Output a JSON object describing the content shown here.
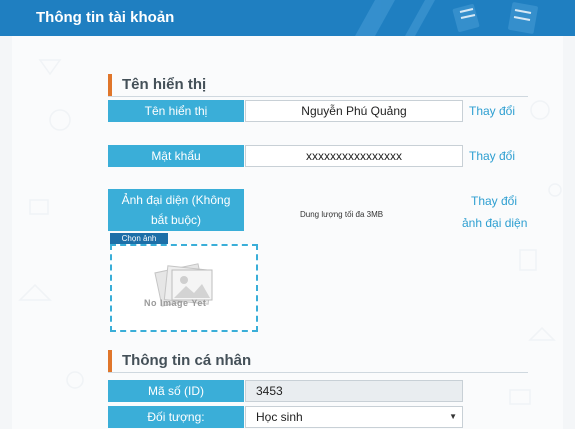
{
  "header": {
    "title": "Thông tin tài khoản"
  },
  "display_section": {
    "title": "Tên hiển thị"
  },
  "display_name": {
    "label": "Tên hiển thị",
    "value": "Nguyễn Phú Quảng",
    "action": "Thay đổi"
  },
  "password": {
    "label": "Mật khẩu",
    "value": "xxxxxxxxxxxxxxxx",
    "action": "Thay đổi"
  },
  "avatar": {
    "label_line1": "Ảnh đại diện (Không",
    "label_line2": "bắt buộc)",
    "note": "Dung lượng tối đa 3MB",
    "action_line1": "Thay đổi",
    "action_line2": "ảnh đại diện",
    "choose_button": "Chọn ảnh",
    "placeholder_text": "No Image Yet"
  },
  "personal_section": {
    "title": "Thông tin cá nhân"
  },
  "user_id": {
    "label": "Mã số (ID)",
    "value": "3453"
  },
  "user_type": {
    "label": "Đối tượng:",
    "value": "Học sinh"
  },
  "colors": {
    "header": "#1f7fc1",
    "label_bg": "#3aaed8",
    "accent": "#e0762b",
    "link": "#2e9fd1"
  }
}
